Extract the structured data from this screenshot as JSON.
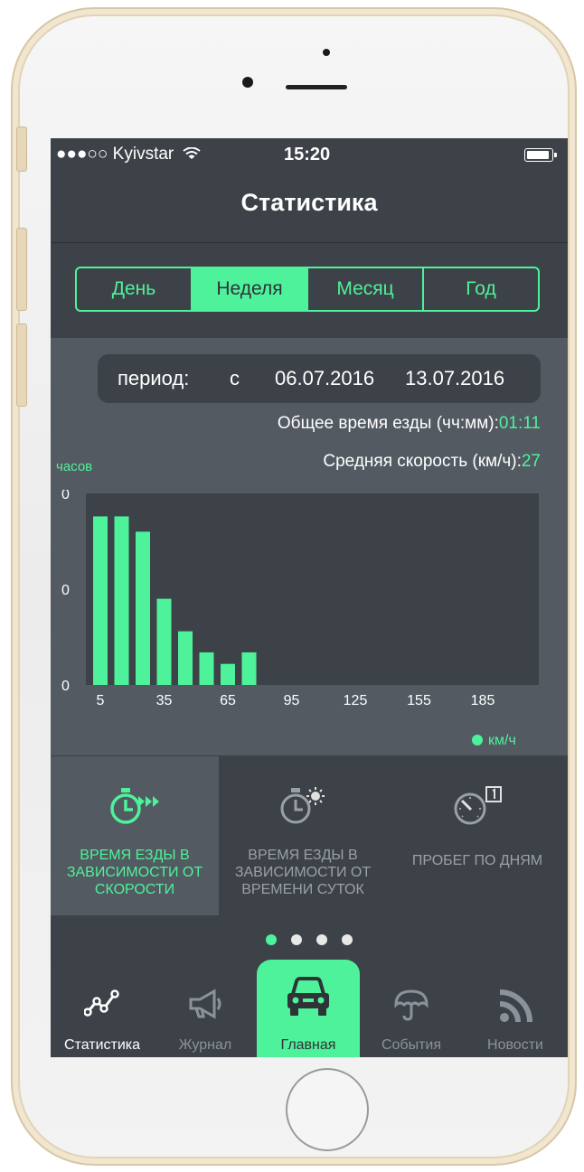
{
  "status_bar": {
    "signal": "●●●○○",
    "carrier": "Kyivstar",
    "time": "15:20"
  },
  "header": {
    "title": "Статистика"
  },
  "period_tabs": [
    {
      "label": "День",
      "active": false
    },
    {
      "label": "Неделя",
      "active": true
    },
    {
      "label": "Месяц",
      "active": false
    },
    {
      "label": "Год",
      "active": false
    }
  ],
  "period": {
    "label": "период:",
    "from_prefix": "с",
    "from": "06.07.2016",
    "to": "13.07.2016"
  },
  "stats": {
    "total_time_label": "Общее время езды (чч:мм):",
    "total_time_value": "01:11",
    "avg_speed_label": "Средняя скорость (км/ч):",
    "avg_speed_value": "27"
  },
  "chart_data": {
    "type": "bar",
    "ylabel": "часов",
    "legend": "км/ч",
    "y_tick_labels": [
      "0",
      "0",
      "0"
    ],
    "x_tick_labels": [
      "5",
      "35",
      "65",
      "95",
      "125",
      "155",
      "185"
    ],
    "x": [
      5,
      15,
      25,
      35,
      45,
      55,
      65,
      75
    ],
    "values": [
      0.88,
      0.88,
      0.8,
      0.45,
      0.28,
      0.17,
      0.11,
      0.17
    ],
    "ylim": [
      0,
      1
    ],
    "xlim": [
      0,
      210
    ],
    "bar_color": "#4ef29a"
  },
  "cards": [
    {
      "label": "ВРЕМЯ ЕЗДЫ В ЗАВИСИМОСТИ ОТ СКОРОСТИ",
      "icon": "stopwatch-fast-icon",
      "active": true
    },
    {
      "label": "ВРЕМЯ ЕЗДЫ В ЗАВИСИМОСТИ ОТ ВРЕМЕНИ СУТОК",
      "icon": "stopwatch-sun-icon",
      "active": false
    },
    {
      "label": "ПРОБЕГ ПО ДНЯМ",
      "icon": "speedometer-calendar-icon",
      "active": false
    }
  ],
  "page_dots": {
    "count": 4,
    "active": 0
  },
  "tabbar": [
    {
      "label": "Статистика",
      "icon": "stats-graph-icon",
      "active": true
    },
    {
      "label": "Журнал",
      "icon": "megaphone-icon",
      "active": false
    },
    {
      "label": "Главная",
      "icon": "car-icon",
      "active": false
    },
    {
      "label": "События",
      "icon": "umbrella-icon",
      "active": false
    },
    {
      "label": "Новости",
      "icon": "rss-icon",
      "active": false
    }
  ],
  "colors": {
    "accent": "#4ef29a",
    "bg": "#3d4248",
    "panel": "#535a62",
    "chart_bg": "#3d4248"
  }
}
